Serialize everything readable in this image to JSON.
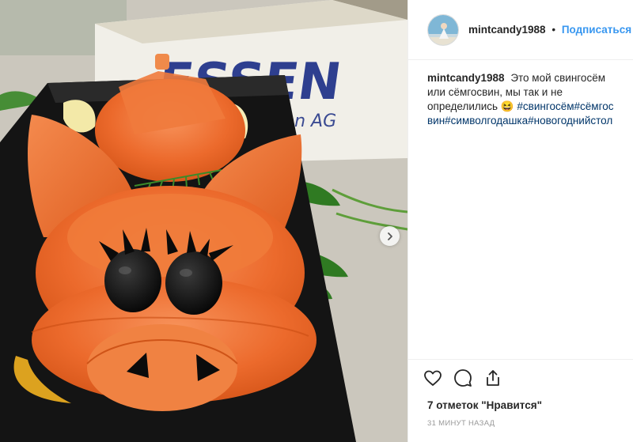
{
  "post": {
    "username": "mintcandy1988",
    "separator": "•",
    "follow_label": "Подписаться",
    "caption_user": "mintcandy1988",
    "caption_text": "Это мой свингосём или сёмгосвин, мы так и не определились 😆",
    "caption_tags": "#свингосём#сёмгосвин#символгодашка#новогоднийстол",
    "likes": "7 отметок \"Нравится\"",
    "time": "31 МИНУТ НАЗАД"
  },
  "photo": {
    "box_text_top": "ESSEN",
    "box_text_bottom": "ton AG"
  },
  "colors": {
    "follow": "#3897f0",
    "tags": "#003569",
    "salmon": "#ec6a2c",
    "plate": "#141414"
  },
  "icons": [
    "heart-icon",
    "comment-icon",
    "share-icon",
    "chevron-right-icon"
  ]
}
